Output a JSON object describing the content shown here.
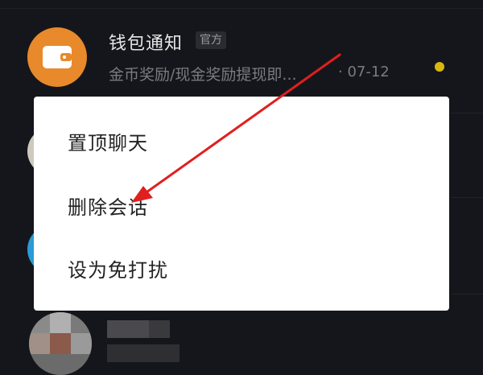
{
  "conversations": {
    "wallet": {
      "icon": "wallet-icon",
      "title": "钱包通知",
      "badge": "官方",
      "preview": "金币奖励/现金奖励提现即...",
      "time": "· 07-12",
      "unread_dot_color": "#d8b80f",
      "avatar_color": "#e8892b"
    }
  },
  "context_menu": {
    "items": [
      {
        "label": "置顶聊天"
      },
      {
        "label": "删除会话"
      },
      {
        "label": "设为免打扰"
      }
    ]
  },
  "annotation": {
    "arrow_color": "#e01f1f",
    "points_to": "删除会话"
  },
  "colors": {
    "background": "#15161b",
    "menu_background": "#ffffff",
    "menu_text": "#222222"
  }
}
